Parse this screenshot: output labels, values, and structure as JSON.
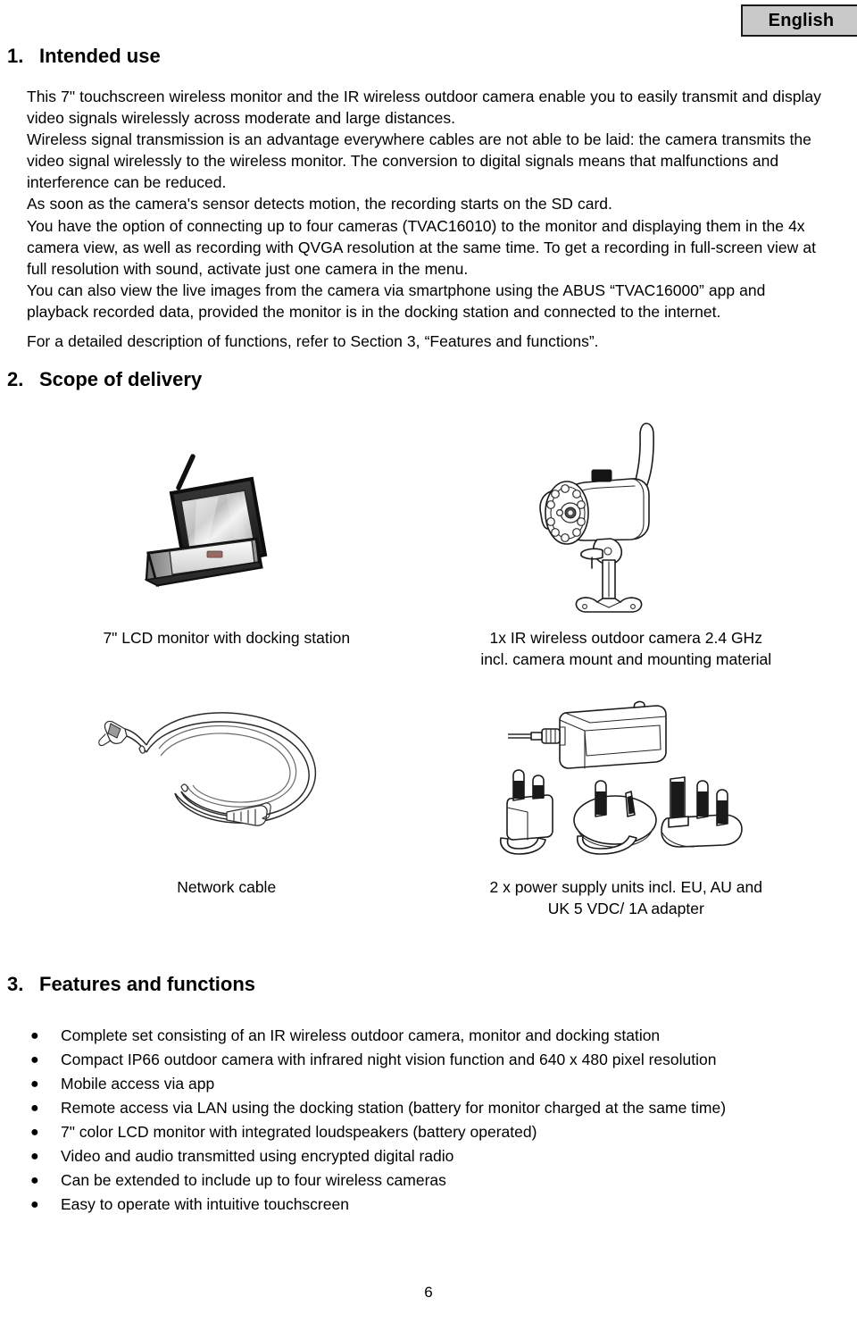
{
  "language_badge": {
    "label": "English"
  },
  "sections": {
    "intended_use": {
      "number": "1.",
      "title": "Intended use",
      "paragraphs": [
        "This 7\" touchscreen wireless monitor and the IR wireless outdoor camera enable you to easily transmit and display video signals wirelessly across moderate and large distances.",
        "Wireless signal transmission is an advantage everywhere cables are not able to be laid: the camera transmits the video signal wirelessly to the wireless monitor. The conversion to digital signals means that malfunctions and interference can be reduced.",
        "As soon as the camera's sensor detects motion, the recording starts on the SD card.",
        "You have the option of connecting up to four cameras (TVAC16010) to the monitor and displaying them in the 4x camera view, as well as recording with QVGA resolution at the same time. To get a recording in full-screen view at full resolution with sound, activate just one camera in the menu.",
        "You can also view the live images from the camera via smartphone using the ABUS “TVAC16000” app and playback recorded data, provided the monitor is in the docking station and connected to the internet."
      ],
      "reference_note": "For a detailed description of functions, refer to Section 3, “Features and functions”."
    },
    "scope_of_delivery": {
      "number": "2.",
      "title": "Scope of delivery",
      "items": [
        {
          "image": "lcd-monitor-docking-station-illustration",
          "caption": "7\" LCD monitor with docking station"
        },
        {
          "image": "ir-wireless-outdoor-camera-illustration",
          "caption": "1x IR wireless outdoor camera 2.4 GHz incl. camera mount and mounting material"
        },
        {
          "image": "network-cable-illustration",
          "caption": "Network cable"
        },
        {
          "image": "power-supply-units-plug-adapters-illustration",
          "caption": "2 x power supply units incl. EU, AU and UK 5 VDC/ 1A adapter"
        }
      ]
    },
    "features_and_functions": {
      "number": "3.",
      "title": "Features and functions",
      "bullet_glyph": "●",
      "items": [
        "Complete set consisting of an IR wireless outdoor camera, monitor and docking station",
        "Compact IP66 outdoor camera with infrared night vision function and 640 x 480 pixel resolution",
        "Mobile access via app",
        "Remote access via LAN using the docking station (battery for monitor charged at the same time)",
        "7\" color LCD monitor with integrated loudspeakers (battery operated)",
        "Video and audio transmitted using encrypted digital radio",
        "Can be extended to include up to four wireless cameras",
        "Easy to operate with intuitive touchscreen"
      ]
    }
  },
  "footer": {
    "page_number": "6"
  },
  "colors": {
    "badge_background": "#c9c9c9",
    "badge_border": "#1a1a1a",
    "text": "#000000",
    "page_background": "#ffffff"
  }
}
